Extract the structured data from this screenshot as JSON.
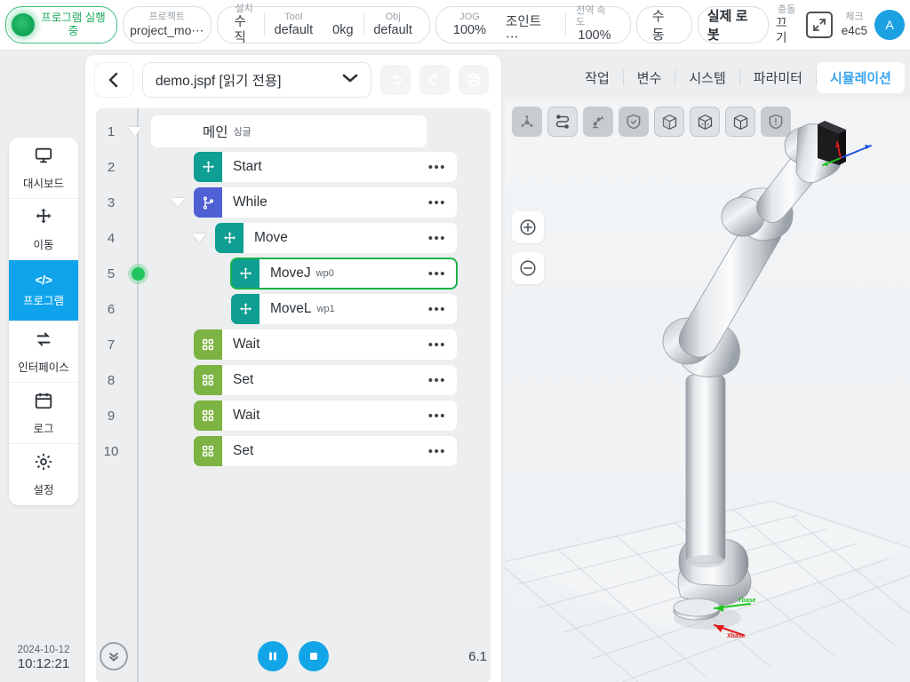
{
  "topbar": {
    "status": {
      "line1": "프로그램 실행",
      "line2": "중",
      "color": "#1aa85c"
    },
    "project": {
      "cap": "프로젝트",
      "val": "project_mo⋯"
    },
    "install": {
      "cap": "설치",
      "val": "수직"
    },
    "tool": {
      "cap": "Tool",
      "val": "default"
    },
    "payload": {
      "val": "0kg"
    },
    "obj": {
      "cap": "Obj",
      "val": "default"
    },
    "jog": {
      "cap": "JOG",
      "val": "100%",
      "mode": "조인트 ⋯"
    },
    "global_speed": {
      "cap": "전역 속도",
      "val": "100%"
    },
    "mode_button": "수동",
    "robot_button": "실제 로봇",
    "collision": {
      "cap": "충돌",
      "val": "끄기"
    },
    "check": {
      "cap": "체크",
      "val": "e4c5"
    },
    "avatar": "A"
  },
  "sidebar": {
    "items": [
      {
        "label": "대시보드",
        "icon": "monitor-icon",
        "active": false
      },
      {
        "label": "이동",
        "icon": "move-icon",
        "active": false
      },
      {
        "label": "프로그램",
        "icon": "code-icon",
        "active": true
      },
      {
        "label": "인터페이스",
        "icon": "sync-icon",
        "active": false
      },
      {
        "label": "로그",
        "icon": "calendar-icon",
        "active": false
      },
      {
        "label": "설정",
        "icon": "gear-icon",
        "active": false
      }
    ],
    "active_color": "#0fa3ec"
  },
  "program": {
    "file_name": "demo.jspf [읽기 전용]",
    "back_icon": "chevron-left-icon",
    "dropdown_icon": "chevron-down-icon",
    "actions": [
      {
        "name": "undo-button",
        "icon": "undo-icon",
        "enabled": false
      },
      {
        "name": "redo-button",
        "icon": "redo-icon",
        "enabled": false
      },
      {
        "name": "save-button",
        "icon": "save-icon",
        "enabled": false
      }
    ],
    "tree": [
      {
        "line": "1",
        "label": "메인",
        "sub": "싱글",
        "type": "main",
        "indent": 0,
        "caret": true,
        "dots": false,
        "selected": false,
        "running": false
      },
      {
        "line": "2",
        "label": "Start",
        "sub": "",
        "type": "move",
        "indent": 1,
        "caret": false,
        "dots": true,
        "selected": false,
        "running": false
      },
      {
        "line": "3",
        "label": "While",
        "sub": "",
        "type": "logic",
        "indent": 1,
        "caret": true,
        "dots": true,
        "selected": false,
        "running": false
      },
      {
        "line": "4",
        "label": "Move",
        "sub": "",
        "type": "move",
        "indent": 2,
        "caret": true,
        "dots": true,
        "selected": false,
        "running": false
      },
      {
        "line": "5",
        "label": "MoveJ",
        "sub": "wp0",
        "type": "move",
        "indent": 3,
        "caret": false,
        "dots": true,
        "selected": true,
        "running": true
      },
      {
        "line": "6",
        "label": "MoveL",
        "sub": "wp1",
        "type": "move",
        "indent": 3,
        "caret": false,
        "dots": true,
        "selected": false,
        "running": false
      },
      {
        "line": "7",
        "label": "Wait",
        "sub": "",
        "type": "io",
        "indent": 1,
        "caret": false,
        "dots": true,
        "selected": false,
        "running": false
      },
      {
        "line": "8",
        "label": "Set",
        "sub": "",
        "type": "io",
        "indent": 1,
        "caret": false,
        "dots": true,
        "selected": false,
        "running": false
      },
      {
        "line": "9",
        "label": "Wait",
        "sub": "",
        "type": "io",
        "indent": 1,
        "caret": false,
        "dots": true,
        "selected": false,
        "running": false
      },
      {
        "line": "10",
        "label": "Set",
        "sub": "",
        "type": "io",
        "indent": 1,
        "caret": false,
        "dots": true,
        "selected": false,
        "running": false
      }
    ],
    "footer": {
      "collapse_icon": "chevron-double-down-icon",
      "pause_icon": "pause-icon",
      "stop_icon": "stop-icon",
      "version": "6.1"
    }
  },
  "clock": {
    "date": "2024-10-12",
    "time": "10:12:21"
  },
  "right_panel": {
    "tabs": [
      {
        "label": "작업",
        "active": false
      },
      {
        "label": "변수",
        "active": false
      },
      {
        "label": "시스템",
        "active": false
      },
      {
        "label": "파라미터",
        "active": false
      },
      {
        "label": "시뮬레이션",
        "active": true
      }
    ],
    "active_tab_color": "#3aa6ef",
    "sim_tools": [
      {
        "name": "tcp-axes-icon",
        "active": false
      },
      {
        "name": "trajectory-path-icon",
        "active": true
      },
      {
        "name": "robot-arm-icon",
        "active": false
      },
      {
        "name": "shield-check-icon",
        "active": false
      },
      {
        "name": "cube-solid-icon",
        "active": true
      },
      {
        "name": "cube-wire-icon",
        "active": true
      },
      {
        "name": "cube-outline-icon",
        "active": true
      },
      {
        "name": "shield-warning-icon",
        "active": false
      }
    ],
    "zoom_in": "plus-icon",
    "zoom_out": "minus-icon",
    "axes": {
      "x_label": "Xbase",
      "y_label": "Ybase",
      "x_color": "#e01b1b",
      "y_color": "#1fc41f",
      "z_color": "#1b4fe0"
    }
  }
}
